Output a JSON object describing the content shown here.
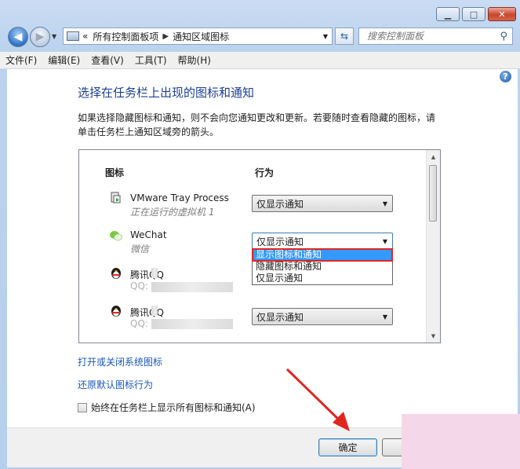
{
  "window": {
    "caption_buttons": [
      "minimize",
      "maximize",
      "close"
    ]
  },
  "address": {
    "prefix": "«",
    "breadcrumb": [
      "所有控制面板项",
      "通知区域图标"
    ]
  },
  "search": {
    "placeholder": "搜索控制面板"
  },
  "menu": [
    "文件(F)",
    "编辑(E)",
    "查看(V)",
    "工具(T)",
    "帮助(H)"
  ],
  "main": {
    "help": "?",
    "title": "选择在任务栏上出现的图标和通知",
    "description_line1": "如果选择隐藏图标和通知，则不会向您通知更改和更新。若要随时查看隐藏的图标，请",
    "description_line2": "单击任务栏上通知区域旁的箭头。",
    "columns": {
      "icon": "图标",
      "behavior": "行为"
    },
    "rows": [
      {
        "name": "VMware Tray Process",
        "sub": "正在运行的虚拟机 1",
        "behavior": "仅显示通知",
        "icon": "vmware-icon"
      },
      {
        "name": "WeChat",
        "sub": "微信",
        "behavior": "仅显示通知",
        "icon": "wechat-icon"
      },
      {
        "name": "腾讯QQ",
        "sub": "QQ: ",
        "behavior": "",
        "icon": "qq-penguin-icon"
      },
      {
        "name": "腾讯QQ",
        "sub": "QQ: ",
        "behavior": "仅显示通知",
        "icon": "qq-penguin-icon"
      }
    ],
    "dropdown_options": [
      "显示图标和通知",
      "隐藏图标和通知",
      "仅显示通知"
    ],
    "dropdown_highlighted": "显示图标和通知",
    "link_system_icons": "打开或关闭系统图标",
    "link_restore_defaults": "还原默认图标行为",
    "always_show_label": "始终在任务栏上显示所有图标和通知(A)"
  },
  "footer": {
    "ok_label": "确定",
    "cancel_label": ""
  },
  "colors": {
    "accent_red": "#e0261f",
    "selection_blue": "#3399ff",
    "link_blue": "#1a57b8",
    "title_blue": "#1c3f94"
  }
}
